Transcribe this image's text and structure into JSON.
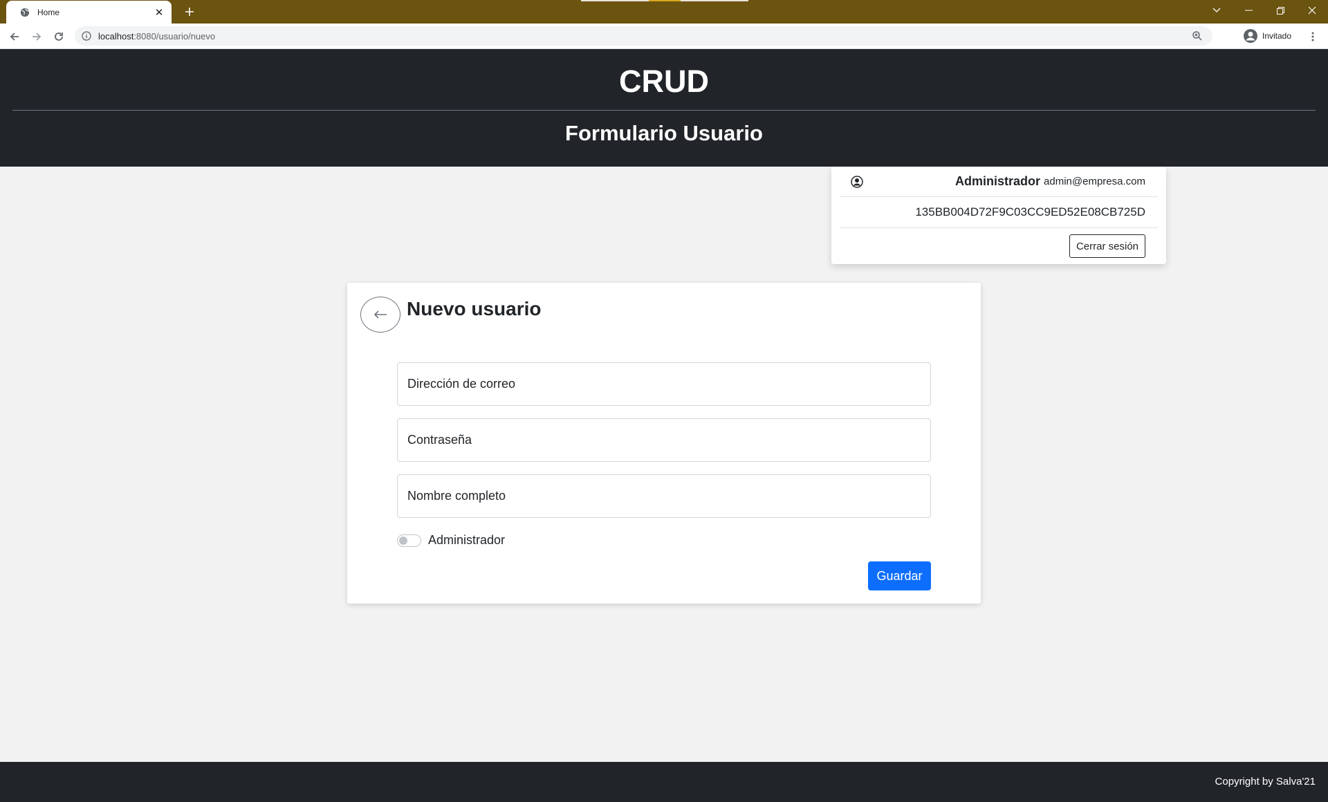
{
  "browser": {
    "tab_title": "Home",
    "url_host": "localhost",
    "url_rest": ":8080/usuario/nuevo",
    "profile_label": "Invitado",
    "icons": [
      "globe-icon",
      "close-icon",
      "plus-icon",
      "back-icon",
      "forward-icon",
      "reload-icon",
      "info-icon",
      "zoom-icon",
      "profile-icon",
      "menu-icon"
    ]
  },
  "header": {
    "brand": "CRUD",
    "subtitle": "Formulario Usuario"
  },
  "user_card": {
    "role": "Administrador",
    "email": "admin@empresa.com",
    "session_id": "135BB004D72F9C03CC9ED52E08CB725D",
    "logout_label": "Cerrar sesión"
  },
  "form": {
    "title": "Nuevo usuario",
    "email_placeholder": "Dirección de correo",
    "password_placeholder": "Contraseña",
    "name_placeholder": "Nombre completo",
    "admin_label": "Administrador",
    "admin_checked": false,
    "save_label": "Guardar"
  },
  "footer": {
    "copyright": "Copyright by Salva'21"
  },
  "colors": {
    "tabbar": "#6b5310",
    "header_bg": "#212529",
    "page_bg": "#f2f2f2",
    "primary": "#0d6efd"
  }
}
